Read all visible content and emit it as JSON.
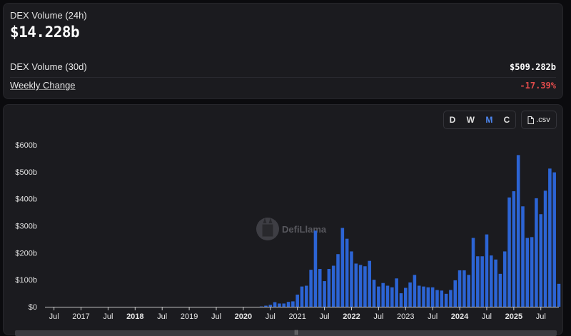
{
  "stats": {
    "volume_24h_label": "DEX Volume (24h)",
    "volume_24h_value": "$14.228b",
    "volume_30d_label": "DEX Volume (30d)",
    "volume_30d_value": "$509.282b",
    "weekly_change_label": "Weekly Change",
    "weekly_change_value": "-17.39%",
    "negative_color": "#e04b4b"
  },
  "controls": {
    "period_options": [
      "D",
      "W",
      "M",
      "C"
    ],
    "active_period": "M",
    "csv_label": ".csv",
    "csv_icon": "file-icon"
  },
  "watermark": {
    "text": "DefiLlama",
    "icon": "llama-logo"
  },
  "colors": {
    "bar": "#2c64d4",
    "active": "#4d86ef"
  },
  "chart_data": {
    "type": "bar",
    "title": "",
    "xlabel": "",
    "ylabel": "",
    "ylim": [
      0,
      600
    ],
    "y_unit": "billions USD",
    "y_ticks": [
      0,
      100,
      200,
      300,
      400,
      500,
      600
    ],
    "y_tick_labels": [
      "$0",
      "$100b",
      "$200b",
      "$300b",
      "$400b",
      "$500b",
      "$600b"
    ],
    "x_ticks": [
      {
        "date": "2016-07",
        "label": "Jul",
        "bold": false
      },
      {
        "date": "2017-01",
        "label": "2017",
        "bold": false
      },
      {
        "date": "2017-07",
        "label": "Jul",
        "bold": false
      },
      {
        "date": "2018-01",
        "label": "2018",
        "bold": true
      },
      {
        "date": "2018-07",
        "label": "Jul",
        "bold": false
      },
      {
        "date": "2019-01",
        "label": "2019",
        "bold": false
      },
      {
        "date": "2019-07",
        "label": "Jul",
        "bold": false
      },
      {
        "date": "2020-01",
        "label": "2020",
        "bold": true
      },
      {
        "date": "2020-07",
        "label": "Jul",
        "bold": false
      },
      {
        "date": "2021-01",
        "label": "2021",
        "bold": false
      },
      {
        "date": "2021-07",
        "label": "Jul",
        "bold": false
      },
      {
        "date": "2022-01",
        "label": "2022",
        "bold": true
      },
      {
        "date": "2022-07",
        "label": "Jul",
        "bold": false
      },
      {
        "date": "2023-01",
        "label": "2023",
        "bold": false
      },
      {
        "date": "2023-07",
        "label": "Jul",
        "bold": false
      },
      {
        "date": "2024-01",
        "label": "2024",
        "bold": true
      },
      {
        "date": "2024-07",
        "label": "Jul",
        "bold": false
      },
      {
        "date": "2025-01",
        "label": "2025",
        "bold": true
      },
      {
        "date": "2025-07",
        "label": "Jul",
        "bold": false
      }
    ],
    "x_range": [
      "2016-05",
      "2025-11"
    ],
    "grid": false,
    "legend": "none",
    "categories": [
      "2020-05",
      "2020-06",
      "2020-07",
      "2020-08",
      "2020-09",
      "2020-10",
      "2020-11",
      "2020-12",
      "2021-01",
      "2021-02",
      "2021-03",
      "2021-04",
      "2021-05",
      "2021-06",
      "2021-07",
      "2021-08",
      "2021-09",
      "2021-10",
      "2021-11",
      "2021-12",
      "2022-01",
      "2022-02",
      "2022-03",
      "2022-04",
      "2022-05",
      "2022-06",
      "2022-07",
      "2022-08",
      "2022-09",
      "2022-10",
      "2022-11",
      "2022-12",
      "2023-01",
      "2023-02",
      "2023-03",
      "2023-04",
      "2023-05",
      "2023-06",
      "2023-07",
      "2023-08",
      "2023-09",
      "2023-10",
      "2023-11",
      "2023-12",
      "2024-01",
      "2024-02",
      "2024-03",
      "2024-04",
      "2024-05",
      "2024-06",
      "2024-07",
      "2024-08",
      "2024-09",
      "2024-10",
      "2024-11",
      "2024-12",
      "2025-01",
      "2025-02",
      "2025-03",
      "2025-04",
      "2025-05",
      "2025-06",
      "2025-07",
      "2025-08",
      "2025-09",
      "2025-10"
    ],
    "values": [
      1,
      4,
      7,
      17,
      12,
      12,
      18,
      20,
      45,
      75,
      78,
      137,
      282,
      140,
      95,
      140,
      152,
      195,
      292,
      252,
      205,
      160,
      155,
      150,
      170,
      100,
      75,
      88,
      78,
      72,
      105,
      50,
      70,
      90,
      118,
      78,
      75,
      72,
      72,
      62,
      60,
      48,
      62,
      98,
      135,
      135,
      118,
      255,
      187,
      187,
      268,
      190,
      175,
      122,
      205,
      405,
      428,
      562,
      372,
      255,
      258,
      402,
      343,
      430,
      512,
      498
    ],
    "partial_last_bar": 85
  }
}
